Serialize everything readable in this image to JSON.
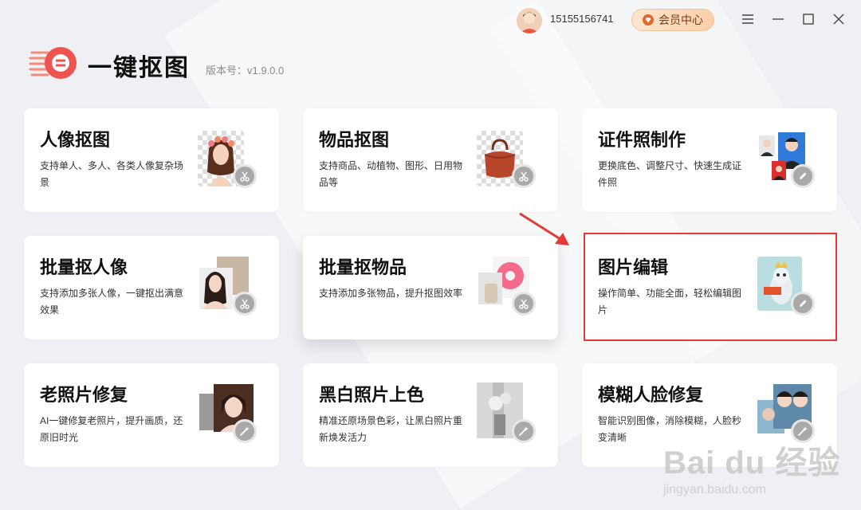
{
  "header": {
    "phone": "15155156741",
    "vip_label": "会员中心"
  },
  "logo": {
    "title": "一键抠图",
    "version": "版本号：v1.9.0.0"
  },
  "cards": [
    {
      "title": "人像抠图",
      "desc": "支持单人、多人、各类人像复杂场景",
      "icon": "scissors-icon"
    },
    {
      "title": "物品抠图",
      "desc": "支持商品、动植物、图形、日用物品等",
      "icon": "scissors-icon"
    },
    {
      "title": "证件照制作",
      "desc": "更换底色、调整尺寸、快速生成证件照",
      "icon": "pencil-icon"
    },
    {
      "title": "批量抠人像",
      "desc": "支持添加多张人像，一键抠出满意效果",
      "icon": "scissors-icon"
    },
    {
      "title": "批量抠物品",
      "desc": "支持添加多张物品，提升抠图效率",
      "icon": "scissors-icon"
    },
    {
      "title": "图片编辑",
      "desc": "操作简单、功能全面，轻松编辑图片",
      "icon": "pencil-icon"
    },
    {
      "title": "老照片修复",
      "desc": "AI一键修复老照片，提升画质，还原旧时光",
      "icon": "wand-icon"
    },
    {
      "title": "黑白照片上色",
      "desc": "精准还原场景色彩，让黑白照片重新焕发活力",
      "icon": "wand-icon"
    },
    {
      "title": "模糊人脸修复",
      "desc": "智能识别图像，消除模糊，人脸秒变清晰",
      "icon": "wand-icon"
    }
  ],
  "watermark": {
    "line1": "Bai du 经验",
    "line2": "jingyan.baidu.com"
  },
  "colors": {
    "accent": "#e53935",
    "background": "#eef0f3",
    "vip_text": "#7a3b12"
  }
}
